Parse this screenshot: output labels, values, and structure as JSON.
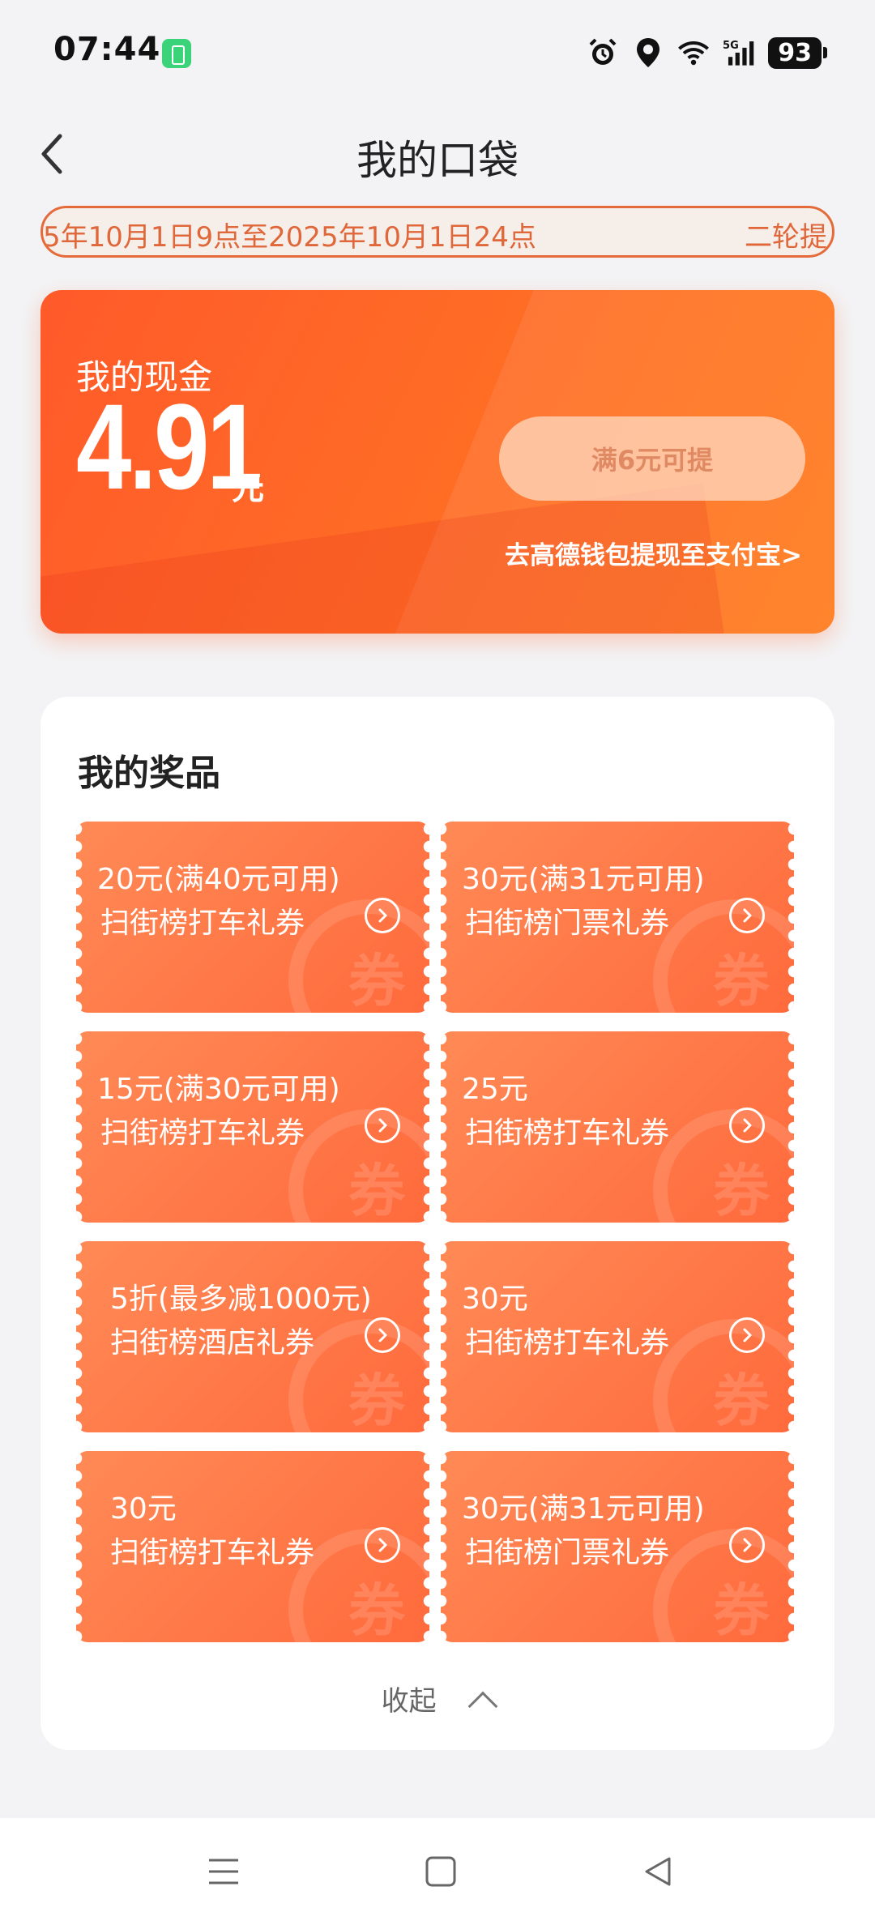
{
  "status_bar": {
    "time": "07:44",
    "battery": "93",
    "icons": [
      "alarm-icon",
      "location-icon",
      "wifi-icon",
      "signal-5g-icon"
    ]
  },
  "nav": {
    "title": "我的口袋"
  },
  "marquee": {
    "text": "5年10月1日9点至2025年10月1日24点",
    "tail": "二轮提"
  },
  "cash": {
    "label": "我的现金",
    "amount": "4.91",
    "unit": "元",
    "withdraw_button": "满6元可提",
    "wallet_link": "去高德钱包提现至支付宝>"
  },
  "prizes": {
    "title": "我的奖品",
    "items": [
      {
        "title": "20元(满40元可用)",
        "subtitle": "扫街榜打车礼券"
      },
      {
        "title": "30元(满31元可用)",
        "subtitle": "扫街榜门票礼券"
      },
      {
        "title": "15元(满30元可用)",
        "subtitle": "扫街榜打车礼券"
      },
      {
        "title": "25元",
        "subtitle": "扫街榜打车礼券"
      },
      {
        "title": "5折(最多减1000元)",
        "subtitle": "扫街榜酒店礼券"
      },
      {
        "title": "30元",
        "subtitle": "扫街榜打车礼券"
      },
      {
        "title": "30元",
        "subtitle": "扫街榜打车礼券"
      },
      {
        "title": "30元(满31元可用)",
        "subtitle": "扫街榜门票礼券"
      }
    ],
    "watermark": "券",
    "collapse_label": "收起"
  },
  "colors": {
    "accent": "#ff6a2a",
    "coupon": "#ff7a48",
    "background": "#f3f3f5"
  }
}
